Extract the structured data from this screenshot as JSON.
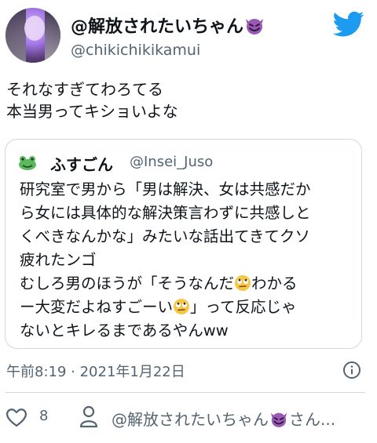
{
  "author": {
    "display_name": "@解放されたいちゃん",
    "handle": "@chikichikikamui",
    "badge_emoji": "smiling-devil-emoji"
  },
  "tweet": {
    "lines": [
      "それなすぎてわろてる",
      "本当男ってキショいよな"
    ]
  },
  "quote": {
    "avatar": "frog-icon",
    "name": "ふすごん",
    "handle": "@Insei_Juso",
    "lines": [
      [
        "研究室で男から「男は解決、女は共感だか"
      ],
      [
        "ら女には具体的な解決策言わずに共感しと"
      ],
      [
        "くべきなんかな」みたいな話出てきてクソ"
      ],
      [
        "疲れたンゴ"
      ],
      [
        "むしろ男のほうが「そうなんだ",
        "わかる"
      ],
      [
        "ー大変だよねすごーい",
        "」って反応じゃ"
      ],
      [
        "ないとキレるまであるやんww"
      ]
    ],
    "inline_emoji": "face-with-rolling-eyes-emoji"
  },
  "timestamp": "午前8:19 · 2021年1月22日",
  "actions": {
    "like_count": "8",
    "reply_text": "@解放されたいちゃん",
    "reply_suffix": "さん..."
  },
  "colors": {
    "twitter_blue": "#1d9bf0",
    "text": "#0f1419",
    "secondary": "#536471",
    "border": "#cfd9de"
  }
}
